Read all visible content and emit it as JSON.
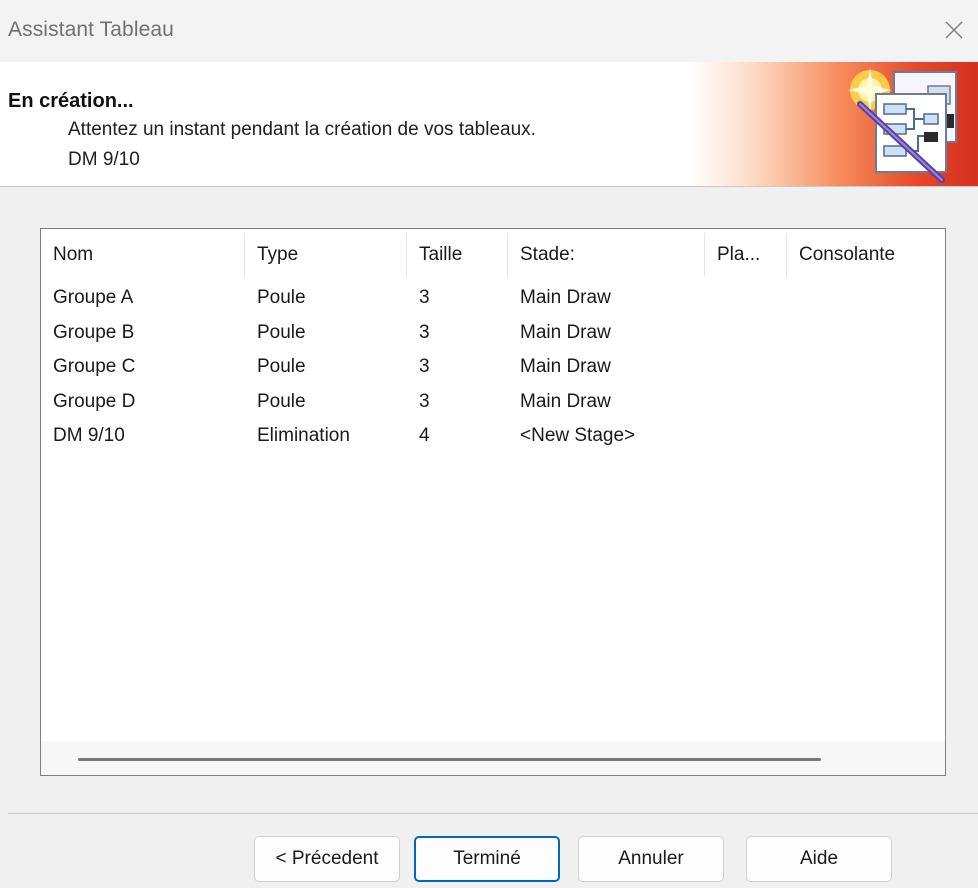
{
  "window": {
    "title": "Assistant Tableau"
  },
  "header": {
    "title": "En création...",
    "subtitle": "Attentez un instant pendant la création de vos tableaux.",
    "current_item": "DM 9/10",
    "banner_colors": [
      "#ffffff",
      "#f68c5c",
      "#d2321e"
    ],
    "icon": "bracket-wizard-icon"
  },
  "table": {
    "columns": [
      "Nom",
      "Type",
      "Taille",
      "Stade:",
      "Pla...",
      "Consolante"
    ],
    "rows": [
      [
        "Groupe A",
        "Poule",
        "3",
        "Main Draw",
        "",
        ""
      ],
      [
        "Groupe B",
        "Poule",
        "3",
        "Main Draw",
        "",
        ""
      ],
      [
        "Groupe C",
        "Poule",
        "3",
        "Main Draw",
        "",
        ""
      ],
      [
        "Groupe D",
        "Poule",
        "3",
        "Main Draw",
        "",
        ""
      ],
      [
        "DM 9/10",
        "Elimination",
        "4",
        "<New Stage>",
        "",
        ""
      ]
    ]
  },
  "buttons": {
    "previous": "< Précedent",
    "finish": "Terminé",
    "cancel": "Annuler",
    "help": "Aide"
  },
  "colors": {
    "accent": "#0067c0",
    "window_bg": "#f0f0f0"
  }
}
